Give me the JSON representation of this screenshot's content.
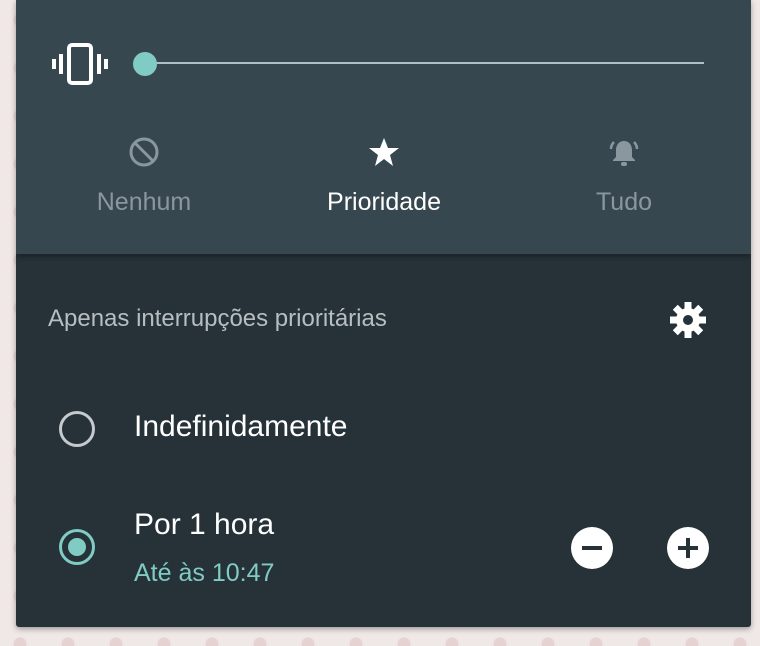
{
  "slider": {
    "level": 0
  },
  "modes": [
    {
      "label": "Nenhum",
      "icon": "block-icon",
      "active": false
    },
    {
      "label": "Prioridade",
      "icon": "star-icon",
      "active": true
    },
    {
      "label": "Tudo",
      "icon": "bell-ringing-icon",
      "active": false
    }
  ],
  "section": {
    "title": "Apenas interrupções prioritárias"
  },
  "options": [
    {
      "label": "Indefinidamente",
      "selected": false
    },
    {
      "label": "Por 1 hora",
      "sublabel": "Até às 10:47",
      "selected": true
    }
  ],
  "colors": {
    "panel": "#263238",
    "top_panel": "#37474f",
    "accent": "#80cbc4",
    "inactive_text": "#8a979e"
  }
}
